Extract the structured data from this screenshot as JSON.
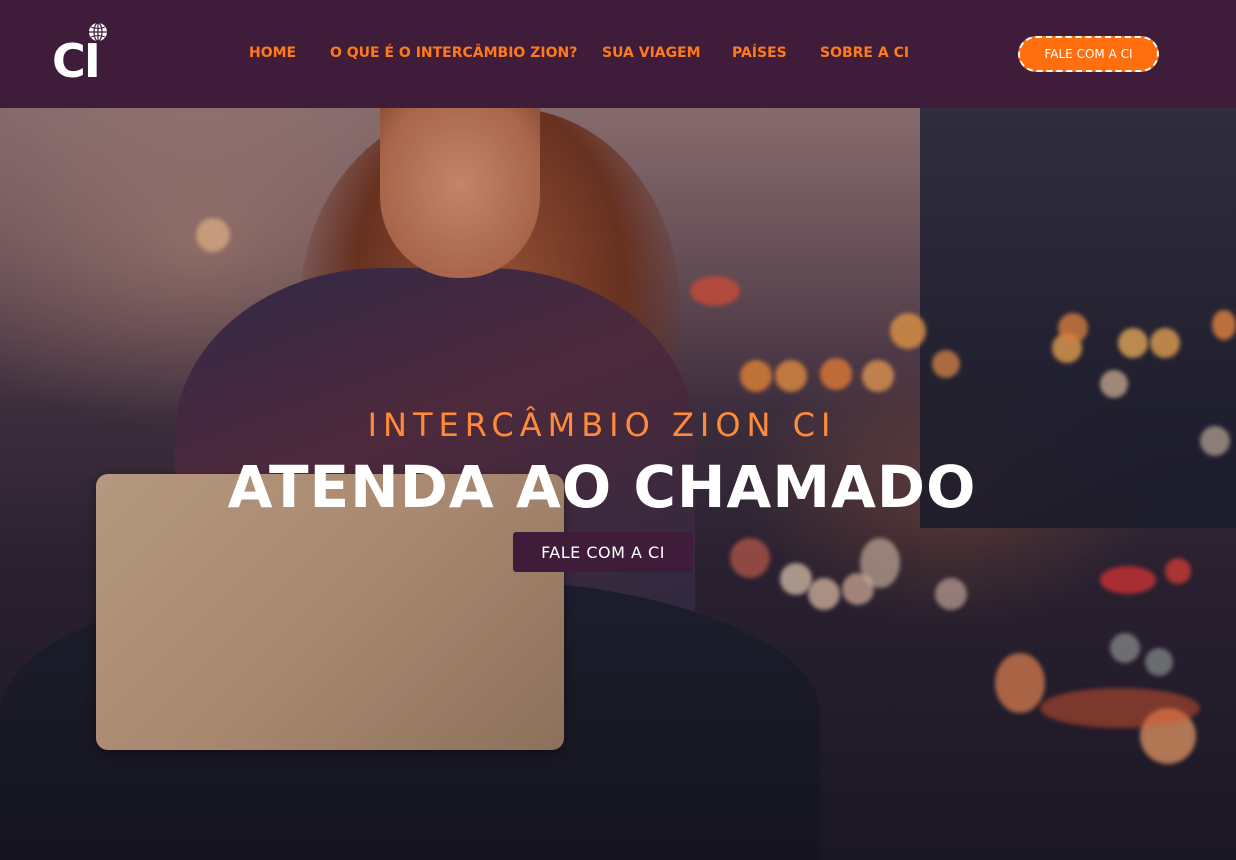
{
  "header": {
    "logo_text": "CI",
    "nav": [
      {
        "label": "HOME"
      },
      {
        "label": "O QUE É O INTERCÂMBIO ZION?"
      },
      {
        "label": "SUA VIAGEM"
      },
      {
        "label": "PAÍSES"
      },
      {
        "label": "SOBRE A CI"
      }
    ],
    "cta_label": "FALE COM A CI"
  },
  "hero": {
    "subtitle": "INTERCÂMBIO ZION CI",
    "title": "ATENDA AO CHAMADO",
    "cta_label": "FALE COM A CI"
  },
  "colors": {
    "header_bg": "#3f1c39",
    "accent_orange": "#ff6f0f",
    "nav_text": "#ff7a1a",
    "hero_cta_bg": "#3f1c39"
  }
}
